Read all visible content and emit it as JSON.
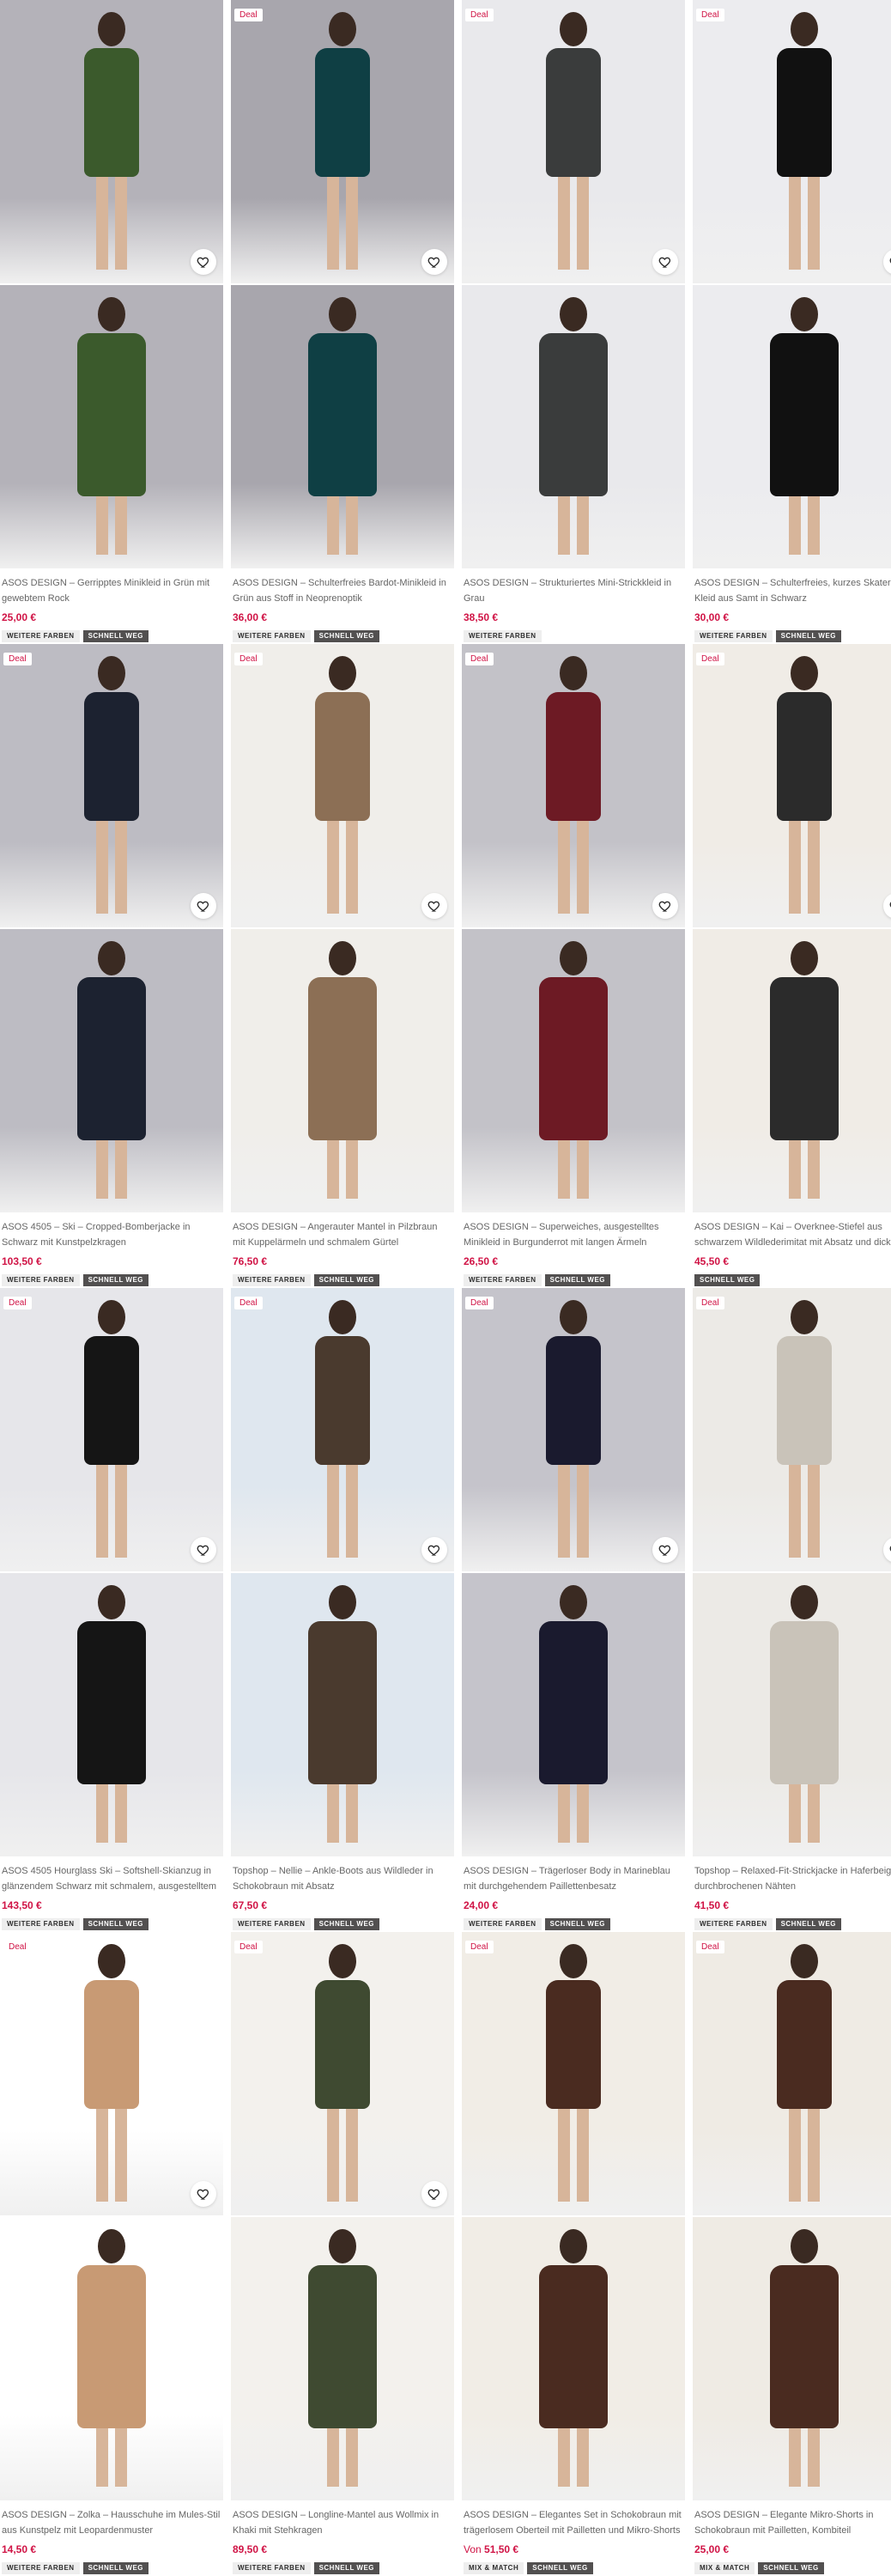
{
  "colors": {
    "deal": "#d01345",
    "badge_dark": "#525050",
    "badge_light": "#eeeeee"
  },
  "badges": {
    "more_colors": "WEITERE FARBEN",
    "selling_fast": "SCHNELL WEG",
    "mix_match": "MIX & MATCH"
  },
  "deal_label": "Deal",
  "products": [
    {
      "title": "ASOS DESIGN – Gerripptes Minikleid in Grün mit gewebtem Rock",
      "price": "25,00 €",
      "deal": false,
      "badges": [
        "more_colors",
        "selling_fast"
      ],
      "fav": true,
      "bg": "#b4b2b9",
      "fg": "#3b5a2c"
    },
    {
      "title": "ASOS DESIGN – Schulterfreies Bardot-Minikleid in Grün aus Stoff in Neoprenoptik",
      "price": "36,00 €",
      "deal": true,
      "badges": [
        "more_colors",
        "selling_fast"
      ],
      "fav": true,
      "bg": "#a8a6ad",
      "fg": "#0f3f44"
    },
    {
      "title": "ASOS DESIGN – Strukturiertes Mini-Strickkleid in Grau",
      "price": "38,50 €",
      "deal": true,
      "badges": [
        "more_colors"
      ],
      "fav": true,
      "bg": "#e9e9ec",
      "fg": "#3a3c3c"
    },
    {
      "title": "ASOS DESIGN – Schulterfreies, kurzes Skater-Kleid aus Samt in Schwarz",
      "price": "30,00 €",
      "deal": true,
      "badges": [
        "more_colors",
        "selling_fast"
      ],
      "fav": true,
      "bg": "#ececef",
      "fg": "#111111"
    },
    {
      "title": "ASOS 4505 – Ski – Cropped-Bomberjacke in Schwarz mit Kunstpelzkragen",
      "price": "103,50 €",
      "deal": true,
      "badges": [
        "more_colors",
        "selling_fast"
      ],
      "fav": true,
      "bg": "#bdbcc3",
      "fg": "#1c2230"
    },
    {
      "title": "ASOS DESIGN – Angerauter Mantel in Pilzbraun mit Kuppelärmeln und schmalem Gürtel",
      "price": "76,50 €",
      "deal": true,
      "badges": [
        "more_colors",
        "selling_fast"
      ],
      "fav": true,
      "bg": "#f0eeea",
      "fg": "#8c6f55"
    },
    {
      "title": "ASOS DESIGN – Superweiches, ausgestelltes Minikleid in Burgunderrot mit langen Ärmeln",
      "price": "26,50 €",
      "deal": true,
      "badges": [
        "more_colors",
        "selling_fast"
      ],
      "fav": true,
      "bg": "#c3c2c8",
      "fg": "#6d1a24"
    },
    {
      "title": "ASOS DESIGN – Kai – Overknee-Stiefel aus schwarzem Wildlederimitat mit Absatz und dicker Sohle",
      "price": "45,50 €",
      "deal": true,
      "badges": [
        "selling_fast"
      ],
      "fav": true,
      "bg": "#f0ece6",
      "fg": "#2b2b2b"
    },
    {
      "title": "ASOS 4505 Hourglass Ski – Softshell-Skianzug in glänzendem Schwarz mit schmalem, ausgestelltem Bein",
      "price": "143,50 €",
      "deal": true,
      "badges": [
        "more_colors",
        "selling_fast"
      ],
      "fav": true,
      "bg": "#e6e6ea",
      "fg": "#151515"
    },
    {
      "title": "Topshop – Nellie – Ankle-Boots aus Wildleder in Schokobraun mit Absatz",
      "price": "67,50 €",
      "deal": true,
      "badges": [
        "more_colors",
        "selling_fast"
      ],
      "fav": true,
      "bg": "#dfe7ef",
      "fg": "#4a3a2e"
    },
    {
      "title": "ASOS DESIGN – Trägerloser Body in Marineblau mit durchgehendem Paillettenbesatz",
      "price": "24,00 €",
      "deal": true,
      "badges": [
        "more_colors",
        "selling_fast"
      ],
      "fav": true,
      "bg": "#c5c4cb",
      "fg": "#1a1a2e"
    },
    {
      "title": "Topshop – Relaxed-Fit-Strickjacke in Haferbeige mit durchbrochenen Nähten",
      "price": "41,50 €",
      "deal": true,
      "badges": [
        "more_colors",
        "selling_fast"
      ],
      "fav": true,
      "bg": "#eceae6",
      "fg": "#c9c3b9"
    },
    {
      "title": "ASOS DESIGN – Zolka – Hausschuhe im Mules-Stil aus Kunstpelz mit Leopardenmuster",
      "price": "14,50 €",
      "deal": true,
      "badges": [
        "more_colors",
        "selling_fast"
      ],
      "fav": true,
      "bg": "#ffffff",
      "fg": "#c89a74"
    },
    {
      "title": "ASOS DESIGN – Longline-Mantel aus Wollmix in Khaki mit Stehkragen",
      "price": "89,50 €",
      "deal": true,
      "badges": [
        "more_colors",
        "selling_fast"
      ],
      "fav": true,
      "bg": "#f3f1ed",
      "fg": "#3f4a31"
    },
    {
      "title": "ASOS DESIGN – Elegantes Set in Schokobraun mit trägerlosem Oberteil mit Pailletten und Mikro-Shorts",
      "price_from": "Von",
      "price": "51,50 €",
      "deal": true,
      "badges": [
        "mix_match",
        "selling_fast"
      ],
      "fav": false,
      "bg": "#f1ede6",
      "fg": "#4a2b20"
    },
    {
      "title": "ASOS DESIGN – Elegante Mikro-Shorts in Schokobraun mit Pailletten, Kombiteil",
      "price": "25,00 €",
      "deal": true,
      "badges": [
        "mix_match",
        "selling_fast"
      ],
      "fav": false,
      "bg": "#efebe4",
      "fg": "#4a2b20"
    }
  ]
}
